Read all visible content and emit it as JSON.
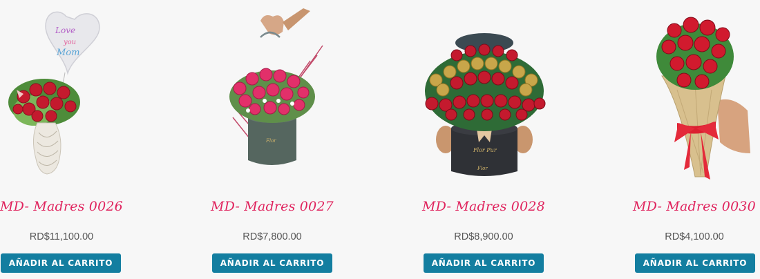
{
  "products": [
    {
      "name": "MD- Madres 0026",
      "price": "RD$11,100.00",
      "button_label": "AÑADIR AL CARRITO"
    },
    {
      "name": "MD- Madres 0027",
      "price": "RD$7,800.00",
      "button_label": "AÑADIR AL CARRITO"
    },
    {
      "name": "MD- Madres 0028",
      "price": "RD$8,900.00",
      "button_label": "AÑADIR AL CARRITO"
    },
    {
      "name": "MD- Madres 0030",
      "price": "RD$4,100.00",
      "button_label": "AÑADIR AL CARRITO"
    }
  ],
  "balloon_text": "Love you Mom",
  "colors": {
    "accent": "#e0245e",
    "button": "#137ea0",
    "price": "#555555",
    "background": "#f7f7f7"
  }
}
